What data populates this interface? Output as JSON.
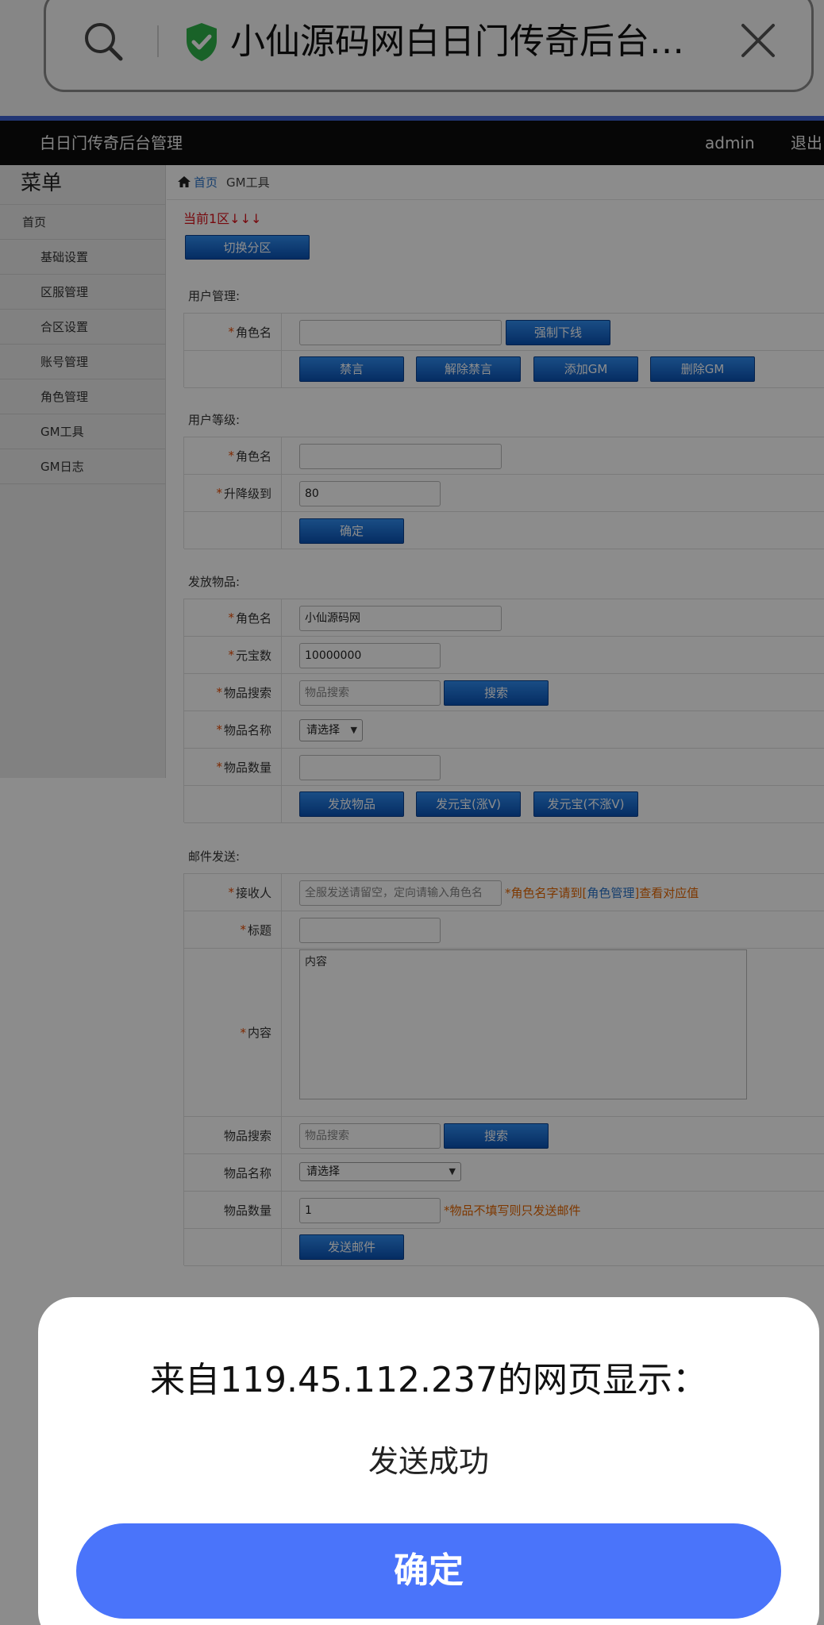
{
  "browser": {
    "url_title": "小仙源码网白日门传奇后台…",
    "icons": {
      "search": "search-icon",
      "security": "shield-check-icon",
      "close": "close-icon"
    },
    "colors": {
      "shield": "#2fb34a",
      "accent_line": "#3f63d4"
    }
  },
  "header": {
    "title": "白日门传奇后台管理",
    "user": "admin",
    "logout": "退出"
  },
  "sidebar": {
    "title": "菜单",
    "items": [
      {
        "label": "首页"
      },
      {
        "label": "基础设置"
      },
      {
        "label": "区服管理"
      },
      {
        "label": "合区设置"
      },
      {
        "label": "账号管理"
      },
      {
        "label": "角色管理"
      },
      {
        "label": "GM工具"
      },
      {
        "label": "GM日志"
      }
    ]
  },
  "breadcrumb": {
    "home": "首页",
    "current": "GM工具",
    "icon": "home-icon"
  },
  "zone": {
    "current": "当前1区↓↓↓",
    "switch_button": "切换分区"
  },
  "user_manage": {
    "title": "用户管理:",
    "role_label": "角色名",
    "kick_button": "强制下线",
    "mute_button": "禁言",
    "unmute_button": "解除禁言",
    "add_gm_button": "添加GM",
    "remove_gm_button": "删除GM"
  },
  "user_level": {
    "title": "用户等级:",
    "role_label": "角色名",
    "level_label": "升降级到",
    "level_value": "80",
    "confirm_button": "确定"
  },
  "give_items": {
    "title": "发放物品:",
    "role_label": "角色名",
    "role_value": "小仙源码网",
    "ingot_label": "元宝数",
    "ingot_value": "10000000",
    "search_label": "物品搜索",
    "search_placeholder": "物品搜索",
    "search_button": "搜索",
    "item_name_label": "物品名称",
    "item_select": "请选择",
    "quantity_label": "物品数量",
    "give_button": "发放物品",
    "ingot_vip_button": "发元宝(涨V)",
    "ingot_novip_button": "发元宝(不涨V)"
  },
  "mail": {
    "title": "邮件发送:",
    "recipient_label": "接收人",
    "recipient_placeholder": "全服发送请留空，定向请输入角色名",
    "recipient_note_pre": "*角色名字请到[",
    "recipient_note_link": "角色管理",
    "recipient_note_post": "]查看对应值",
    "subject_label": "标题",
    "content_label": "内容",
    "content_placeholder": "内容",
    "search_label": "物品搜索",
    "search_placeholder": "物品搜索",
    "search_button": "搜索",
    "item_name_label": "物品名称",
    "item_select": "请选择",
    "quantity_label": "物品数量",
    "quantity_value": "1",
    "quantity_note": "*物品不填写则只发送邮件",
    "send_button": "发送邮件"
  },
  "dialog": {
    "title": "来自119.45.112.237的网页显示：",
    "message": "发送成功",
    "ok_button": "确定",
    "ok_color": "#4a74fa"
  }
}
